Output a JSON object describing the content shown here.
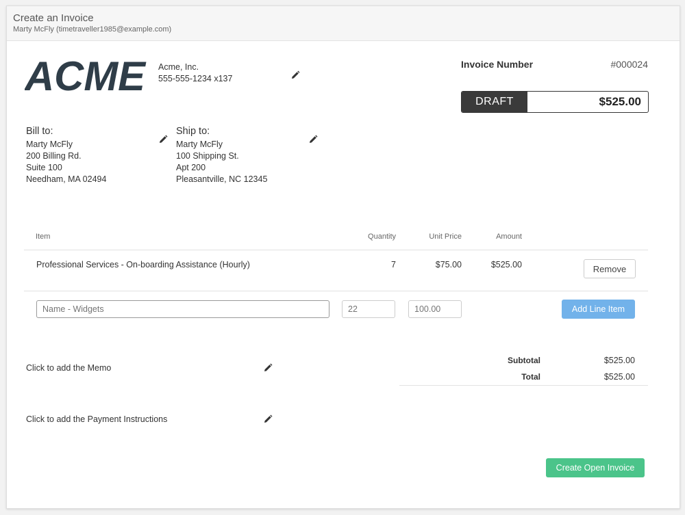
{
  "header": {
    "title": "Create an Invoice",
    "subtitle": "Marty McFly (timetraveller1985@example.com)"
  },
  "company": {
    "logo_text": "ACME",
    "logo_color": "#2f3d48",
    "name": "Acme, Inc.",
    "phone": "555-555-1234 x137"
  },
  "invoice": {
    "number_label": "Invoice Number",
    "number": "#000024",
    "status": "DRAFT",
    "total": "$525.00"
  },
  "bill_to": {
    "title": "Bill to:",
    "lines": [
      "Marty McFly",
      "200 Billing Rd.",
      "Suite 100",
      "Needham, MA 02494"
    ]
  },
  "ship_to": {
    "title": "Ship to:",
    "lines": [
      "Marty McFly",
      "100 Shipping St.",
      "Apt 200",
      "Pleasantville, NC 12345"
    ]
  },
  "table": {
    "headers": {
      "item": "Item",
      "quantity": "Quantity",
      "unit_price": "Unit Price",
      "amount": "Amount"
    },
    "rows": [
      {
        "item": "Professional Services - On-boarding Assistance (Hourly)",
        "quantity": "7",
        "unit_price": "$75.00",
        "amount": "$525.00",
        "action": "Remove"
      }
    ]
  },
  "new_line": {
    "name_placeholder": "Name - Widgets",
    "quantity_placeholder": "22",
    "price_placeholder": "100.00",
    "add_label": "Add Line Item"
  },
  "totals": {
    "subtotal_label": "Subtotal",
    "subtotal": "$525.00",
    "total_label": "Total",
    "total": "$525.00"
  },
  "memo": {
    "label": "Click to add the Memo"
  },
  "payment": {
    "label": "Click to add the Payment Instructions"
  },
  "actions": {
    "create_label": "Create Open Invoice"
  },
  "colors": {
    "draft_bg": "#3a3a3a",
    "add_button": "#72b2ea",
    "create_button": "#4bc48a"
  },
  "icons": {
    "edit": "pencil-icon"
  }
}
